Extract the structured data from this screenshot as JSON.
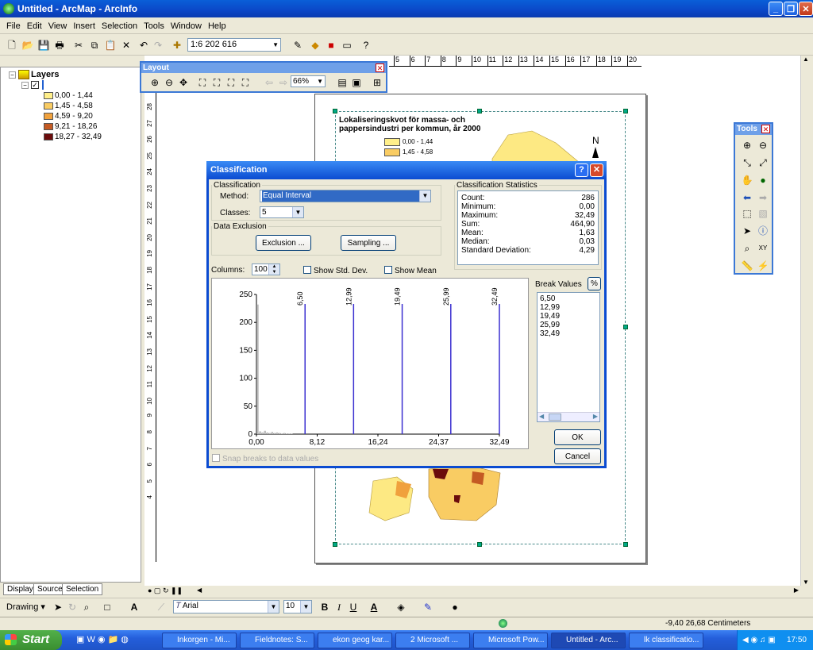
{
  "window": {
    "title": "Untitled - ArcMap - ArcInfo"
  },
  "menu": [
    "File",
    "Edit",
    "View",
    "Insert",
    "Selection",
    "Tools",
    "Window",
    "Help"
  ],
  "toolbar": {
    "scale": "1:6 202 616"
  },
  "toc": {
    "root": "Layers",
    "legend": [
      {
        "label": "0,00 - 1,44",
        "color": "#ffef8a"
      },
      {
        "label": "1,45 - 4,58",
        "color": "#f9cc63"
      },
      {
        "label": "4,59 - 9,20",
        "color": "#f0a13d"
      },
      {
        "label": "9,21 - 18,26",
        "color": "#c45a23"
      },
      {
        "label": "18,27 - 32,49",
        "color": "#6b0c0c"
      }
    ],
    "tabs": [
      "Display",
      "Source",
      "Selection"
    ]
  },
  "layout_toolbar": {
    "title": "Layout",
    "zoom": "66%"
  },
  "tools_toolbar": {
    "title": "Tools"
  },
  "map": {
    "title_line1": "Lokaliseringskvot för massa- och",
    "title_line2": "pappersindustri per kommun, år 2000",
    "legend": [
      "0,00 - 1,44",
      "1,45 - 4,58"
    ],
    "north": "N"
  },
  "ruler": {
    "h": [
      "5",
      "6",
      "7",
      "8",
      "9",
      "10",
      "11",
      "12",
      "13",
      "14",
      "15",
      "16",
      "17",
      "18",
      "19",
      "20"
    ],
    "v": [
      "28",
      "27",
      "26",
      "25",
      "24",
      "23",
      "22",
      "21",
      "20",
      "19",
      "18",
      "17",
      "16",
      "15",
      "14",
      "13",
      "12",
      "11",
      "10",
      "9",
      "8",
      "7",
      "6",
      "5",
      "4"
    ]
  },
  "dialog": {
    "title": "Classification",
    "classification_group": "Classification",
    "method_label": "Method:",
    "method": "Equal Interval",
    "classes_label": "Classes:",
    "classes": "5",
    "exclusion_group": "Data Exclusion",
    "exclusion_btn": "Exclusion ...",
    "sampling_btn": "Sampling ...",
    "stats_group": "Classification Statistics",
    "stats": [
      {
        "k": "Count:",
        "v": "286"
      },
      {
        "k": "Minimum:",
        "v": "0,00"
      },
      {
        "k": "Maximum:",
        "v": "32,49"
      },
      {
        "k": "Sum:",
        "v": "464,90"
      },
      {
        "k": "Mean:",
        "v": "1,63"
      },
      {
        "k": "Median:",
        "v": "0,03"
      },
      {
        "k": "Standard Deviation:",
        "v": "4,29"
      }
    ],
    "columns_label": "Columns:",
    "columns": "100",
    "show_std": "Show Std. Dev.",
    "show_mean": "Show Mean",
    "break_values_label": "Break Values",
    "pct": "%",
    "break_values": [
      "6,50",
      "12,99",
      "19,49",
      "25,99",
      "32,49"
    ],
    "ok": "OK",
    "cancel": "Cancel",
    "snap": "Snap breaks to data values"
  },
  "chart_data": {
    "type": "bar",
    "title": "",
    "ylim": [
      0,
      250
    ],
    "yticks": [
      "250",
      "200",
      "150",
      "100",
      "50",
      "0"
    ],
    "xlim": [
      0,
      32.49
    ],
    "xticks": [
      "0,00",
      "8,12",
      "16,24",
      "24,37",
      "32,49"
    ],
    "x": [
      0.16,
      0.49,
      0.81,
      1.14,
      1.46,
      1.79,
      2.11,
      2.44,
      2.76,
      3.09,
      3.41,
      3.74,
      4.06,
      4.39,
      4.71
    ],
    "values": [
      232,
      5,
      3,
      6,
      3,
      2,
      4,
      2,
      3,
      2,
      1,
      2,
      1,
      1,
      1
    ],
    "breaks": [
      6.5,
      12.99,
      19.49,
      25.99,
      32.49
    ],
    "break_labels": [
      "6,50",
      "12,99",
      "19,49",
      "25,99",
      "32,49"
    ],
    "break_color": "#3a2fd0"
  },
  "drawing": {
    "label": "Drawing",
    "font": "Arial",
    "size": "10"
  },
  "status": {
    "coords": "-9,40  26,68 Centimeters"
  },
  "taskbar": {
    "start": "Start",
    "items": [
      "Inkorgen - Mi...",
      "Fieldnotes: S...",
      "ekon geog kar...",
      "2 Microsoft ...",
      "Microsoft Pow...",
      "Untitled - Arc...",
      "lk classificatio..."
    ],
    "time": "17:50"
  }
}
